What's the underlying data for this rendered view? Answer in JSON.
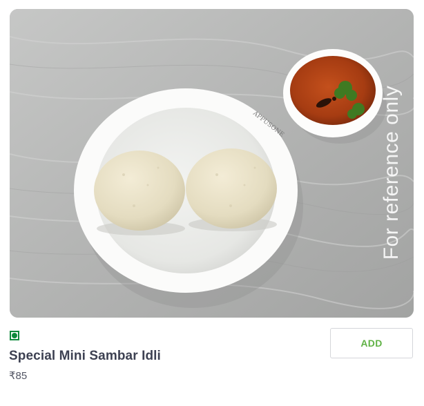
{
  "item": {
    "name": "Special Mini Sambar Idli",
    "price": "₹85",
    "veg_icon": "veg-indicator-icon",
    "veg_color": "#0f8a3c"
  },
  "image": {
    "watermark": "For reference only",
    "plate_brand": "APPUSONE"
  },
  "actions": {
    "add_label": "ADD",
    "add_color": "#60b246"
  }
}
